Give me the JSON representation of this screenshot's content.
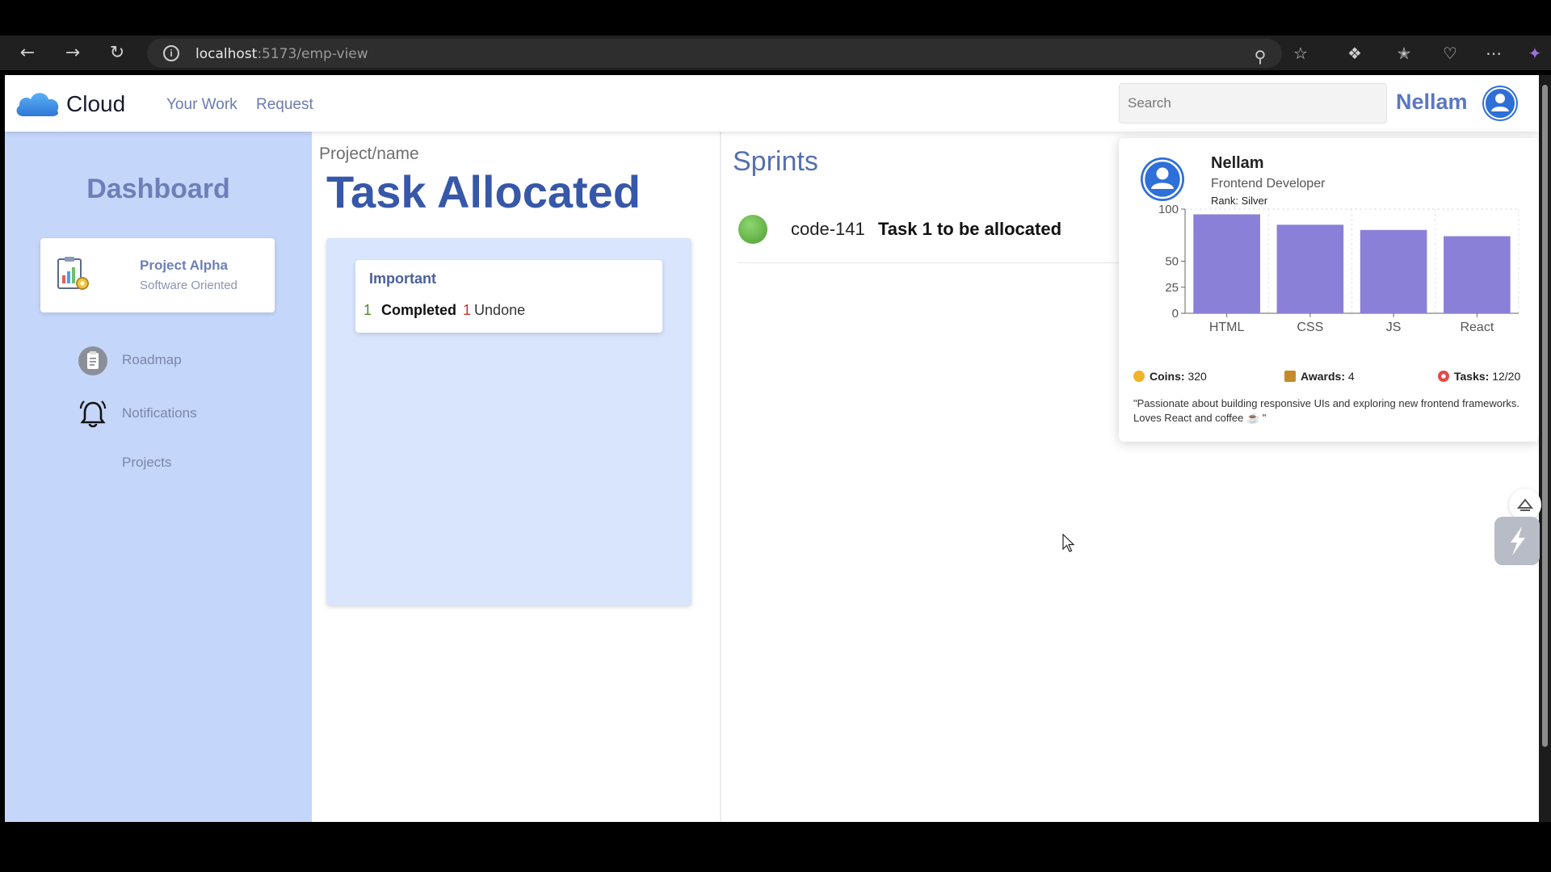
{
  "browser": {
    "url_host": "localhost",
    "url_path": ":5173/emp-view",
    "icons": [
      "back-icon",
      "forward-icon",
      "reload-icon",
      "info-icon",
      "zoom-icon",
      "star-icon",
      "extensions-icon",
      "favorites-icon",
      "shield-icon",
      "more-icon"
    ]
  },
  "header": {
    "logo_text": "Cloud",
    "nav": [
      "Your Work",
      "Request"
    ],
    "search_placeholder": "Search",
    "user_name": "Nellam"
  },
  "sidebar": {
    "title": "Dashboard",
    "project": {
      "name": "Project Alpha",
      "subtitle": "Software Oriented"
    },
    "items": [
      {
        "label": "Roadmap",
        "icon": "clipboard-icon"
      },
      {
        "label": "Notifications",
        "icon": "bell-icon"
      },
      {
        "label": "Projects",
        "icon": ""
      }
    ]
  },
  "main": {
    "breadcrumb": "Project/name",
    "title": "Task Allocated",
    "card": {
      "title": "Important",
      "completed_count": "1",
      "completed_label": "Completed",
      "undone_count": "1",
      "undone_label": "Undone"
    }
  },
  "sprints": {
    "title": "Sprints",
    "items": [
      {
        "code": "code-141",
        "task": "Task 1 to be allocated",
        "status_color": "#5aa83c"
      }
    ]
  },
  "profile": {
    "name": "Nellam",
    "role": "Frontend Developer",
    "rank": "Rank: Silver",
    "stats": {
      "coins_label": "Coins:",
      "coins_value": "320",
      "awards_label": "Awards:",
      "awards_value": "4",
      "tasks_label": "Tasks:",
      "tasks_value": "12/20"
    },
    "bio": "\"Passionate about building responsive UIs and exploring new frontend frameworks. Loves React and coffee ☕ \""
  },
  "colors": {
    "accent": "#3757a8",
    "sidebar_bg": "#c5d6fb",
    "bar": "#8a80d8"
  },
  "chart_data": {
    "type": "bar",
    "categories": [
      "HTML",
      "CSS",
      "JS",
      "React"
    ],
    "values": [
      95,
      85,
      80,
      74
    ],
    "yticks": [
      0,
      25,
      50,
      100
    ],
    "ylim": [
      0,
      100
    ],
    "title": "",
    "xlabel": "",
    "ylabel": "",
    "grid": true
  }
}
